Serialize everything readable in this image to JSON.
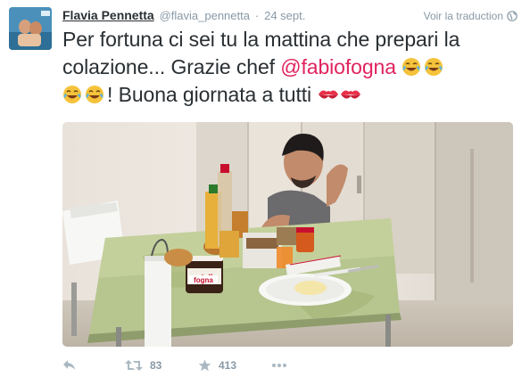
{
  "tweet": {
    "fullname": "Flavia Pennetta",
    "username": "@flavia_pennetta",
    "separator": "·",
    "timestamp": "24 sept.",
    "translate_label": "Voir la traduction",
    "text_part1": "Per fortuna ci sei tu la mattina che prepari la colazione... Grazie chef ",
    "mention": "@fabiofogna",
    "text_part2": "! Buona giornata a tutti ",
    "emojis": [
      "face-with-tears-of-joy",
      "face-with-tears-of-joy",
      "face-with-tears-of-joy",
      "face-with-tears-of-joy",
      "kiss-mark",
      "kiss-mark"
    ],
    "photo_description_icon": "photo",
    "nutella_label": "nutella",
    "fogna_label": "fogna"
  },
  "actions": {
    "reply_icon": "reply-icon",
    "retweet_icon": "retweet-icon",
    "retweet_count": "83",
    "favorite_icon": "star-icon",
    "favorite_count": "413",
    "more_icon": "more-icon"
  },
  "colors": {
    "link": "#e0245e",
    "muted": "#8899a6",
    "icon": "#aab8c2",
    "text": "#292f33"
  }
}
